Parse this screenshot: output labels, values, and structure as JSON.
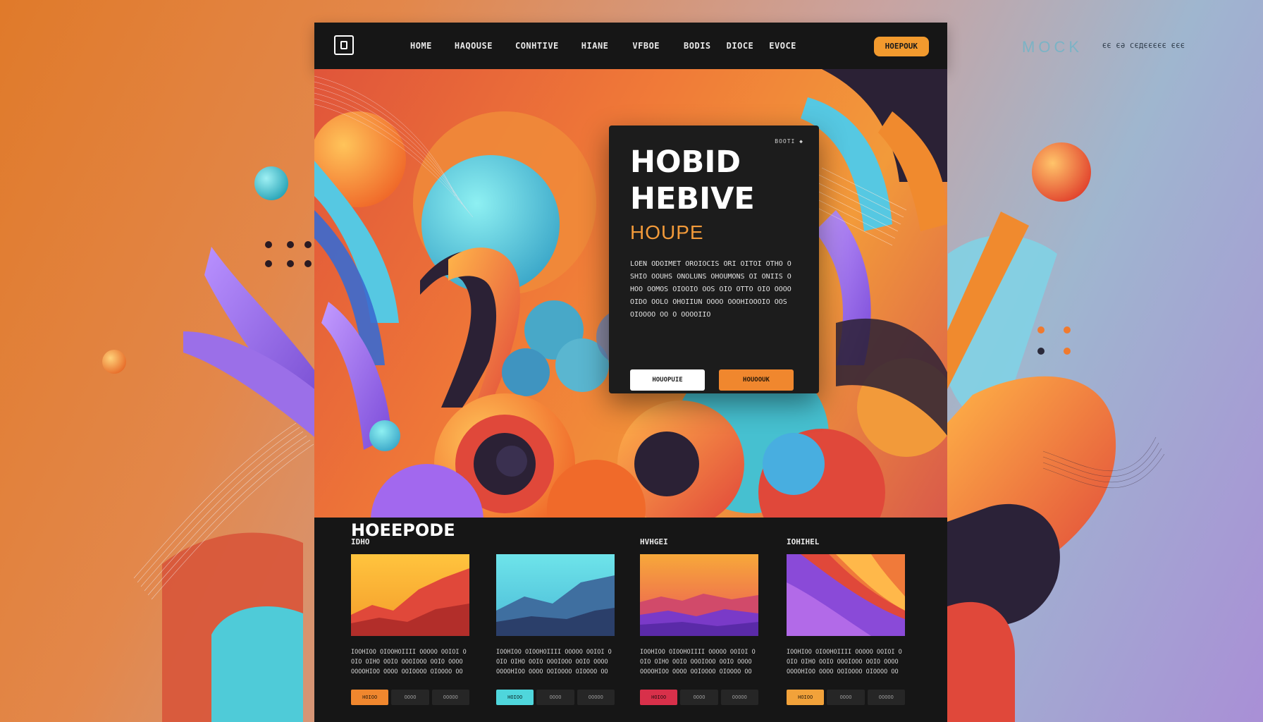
{
  "colors": {
    "accent": "#f29a2e",
    "dark": "#161616",
    "cyan": "#5fd3d9",
    "purple": "#9b5fe0",
    "red": "#e0483a"
  },
  "mock_label": "MOCK",
  "mock_meta": "ЄЄ  ЄӘ СЄДЄЄЄЄЄ ЄЄЄ",
  "nav": {
    "logo_icon": "square-logo-icon",
    "items": [
      "HOME",
      "HAQOUSE",
      "CONHTIVE",
      "HIANE",
      "VFBOE",
      "BODIS",
      "DIOCE",
      "EVOCE"
    ],
    "cta": "HOEPOUK"
  },
  "hero": {
    "tag": "BOOTI ◆",
    "title_line1": "HOBID",
    "title_line2": "HEBIVE",
    "subtitle": "HOUPE",
    "body": "LOEN ODOIMET OROIOCIS ORI OITOI OTHO OSHIO OOUHS ONOLUNS OHOUMONS OI ONIIS OHOO OOMOS OIOOIO OOS OIO OTTO OIO OOOOOIDO OOLO OHOIIUN OOOO OOOHIOOOIO OOS OIOOOO OO O OOOOIIO",
    "btn_primary": "HOUOPUIE",
    "btn_secondary": "HOUOOUK"
  },
  "section": {
    "title": "HOEEPODE",
    "cards": [
      {
        "label": "IDHO",
        "text": "IOOHIOO OIOOHOIIII OOOOO OOIOI OOIO OIHO OOIO OOOIOOO OOIO OOOO OOOOHIOO OOOO OOIOOOO OIOOOO OO",
        "btn1": "HOIOO",
        "btn2": "OOOO",
        "btn3": "OOOOO",
        "accent": "#f0872e"
      },
      {
        "label": "",
        "text": "IOOHIOO OIOOHOIIII OOOOO OOIOI OOIO OIHO OOIO OOOIOOO OOIO OOOO OOOOHIOO OOOO OOIOOOO OIOOOO OO",
        "btn1": "HOIOO",
        "btn2": "OOOO",
        "btn3": "OOOOO",
        "accent": "#4fd6dc"
      },
      {
        "label": "HVHGEI",
        "text": "IOOHIOO OIOOHOIIII OOOOO OOIOI OOIO OIHO OOIO OOOIOOO OOIO OOOO OOOOHIOO OOOO OOIOOOO OIOOOO OO",
        "btn1": "HOIOO",
        "btn2": "OOOO",
        "btn3": "OOOOO",
        "accent": "#d8304a"
      },
      {
        "label": "IOHIHEL",
        "text": "IOOHIOO OIOOHOIIII OOOOO OOIOI OOIO OIHO OOIO OOOIOOO OOIO OOOO OOOOHIOO OOOO OOIOOOO OIOOOO OO",
        "btn1": "HOIOO",
        "btn2": "OOOO",
        "btn3": "OOOOO",
        "accent": "#f2a23a"
      }
    ]
  }
}
